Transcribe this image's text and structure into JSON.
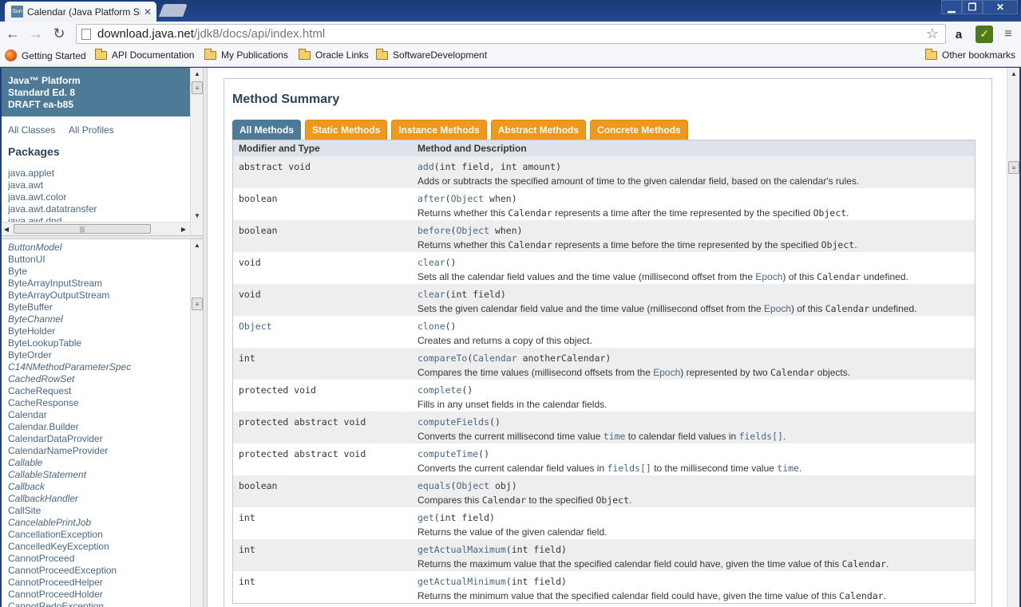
{
  "browser": {
    "tab_title": "Calendar (Java Platform SE",
    "tab_favicon": "Sun",
    "url_host": "download.java.net",
    "url_path": "/jdk8/docs/api/index.html",
    "bookmarks": [
      "Getting Started",
      "API Documentation",
      "My Publications",
      "Oracle Links",
      "SoftwareDevelopment"
    ],
    "other_bookmarks": "Other bookmarks"
  },
  "sidebar": {
    "platform_lines": [
      "Java™ Platform",
      "Standard Ed. 8",
      "DRAFT ea-b85"
    ],
    "all_classes": "All Classes",
    "all_profiles": "All Profiles",
    "packages_title": "Packages",
    "packages": [
      "java.applet",
      "java.awt",
      "java.awt.color",
      "java.awt.datatransfer",
      "java.awt.dnd"
    ],
    "classes": [
      {
        "name": "ButtonModel",
        "italic": true
      },
      {
        "name": "ButtonUI",
        "italic": false
      },
      {
        "name": "Byte",
        "italic": false
      },
      {
        "name": "ByteArrayInputStream",
        "italic": false
      },
      {
        "name": "ByteArrayOutputStream",
        "italic": false
      },
      {
        "name": "ByteBuffer",
        "italic": false
      },
      {
        "name": "ByteChannel",
        "italic": true
      },
      {
        "name": "ByteHolder",
        "italic": false
      },
      {
        "name": "ByteLookupTable",
        "italic": false
      },
      {
        "name": "ByteOrder",
        "italic": false
      },
      {
        "name": "C14NMethodParameterSpec",
        "italic": true
      },
      {
        "name": "CachedRowSet",
        "italic": true
      },
      {
        "name": "CacheRequest",
        "italic": false
      },
      {
        "name": "CacheResponse",
        "italic": false
      },
      {
        "name": "Calendar",
        "italic": false
      },
      {
        "name": "Calendar.Builder",
        "italic": false
      },
      {
        "name": "CalendarDataProvider",
        "italic": false
      },
      {
        "name": "CalendarNameProvider",
        "italic": false
      },
      {
        "name": "Callable",
        "italic": true
      },
      {
        "name": "CallableStatement",
        "italic": true
      },
      {
        "name": "Callback",
        "italic": true
      },
      {
        "name": "CallbackHandler",
        "italic": true
      },
      {
        "name": "CallSite",
        "italic": false
      },
      {
        "name": "CancelablePrintJob",
        "italic": true
      },
      {
        "name": "CancellationException",
        "italic": false
      },
      {
        "name": "CancelledKeyException",
        "italic": false
      },
      {
        "name": "CannotProceed",
        "italic": false
      },
      {
        "name": "CannotProceedException",
        "italic": false
      },
      {
        "name": "CannotProceedHelper",
        "italic": false
      },
      {
        "name": "CannotProceedHolder",
        "italic": false
      },
      {
        "name": "CannotRedoException",
        "italic": false
      }
    ]
  },
  "main": {
    "heading": "Method Summary",
    "tabs": [
      "All Methods",
      "Static Methods",
      "Instance Methods",
      "Abstract Methods",
      "Concrete Methods"
    ],
    "columns": [
      "Modifier and Type",
      "Method and Description"
    ],
    "rows": [
      {
        "type": [
          [
            "abstract void",
            0
          ]
        ],
        "sig": [
          [
            "add",
            1
          ],
          [
            "(int field, int amount)",
            0
          ]
        ],
        "desc": [
          [
            "Adds or subtracts the specified amount of time to the given calendar field, based on the calendar's rules.",
            "t"
          ]
        ]
      },
      {
        "type": [
          [
            "boolean",
            0
          ]
        ],
        "sig": [
          [
            "after",
            1
          ],
          [
            "(",
            0
          ],
          [
            "Object",
            1
          ],
          [
            " when)",
            0
          ]
        ],
        "desc": [
          [
            "Returns whether this ",
            "t"
          ],
          [
            "Calendar",
            "m"
          ],
          [
            " represents a time after the time represented by the specified ",
            "t"
          ],
          [
            "Object",
            "m"
          ],
          [
            ".",
            "t"
          ]
        ]
      },
      {
        "type": [
          [
            "boolean",
            0
          ]
        ],
        "sig": [
          [
            "before",
            1
          ],
          [
            "(",
            0
          ],
          [
            "Object",
            1
          ],
          [
            " when)",
            0
          ]
        ],
        "desc": [
          [
            "Returns whether this ",
            "t"
          ],
          [
            "Calendar",
            "m"
          ],
          [
            " represents a time before the time represented by the specified ",
            "t"
          ],
          [
            "Object",
            "m"
          ],
          [
            ".",
            "t"
          ]
        ]
      },
      {
        "type": [
          [
            "void",
            0
          ]
        ],
        "sig": [
          [
            "clear",
            1
          ],
          [
            "()",
            0
          ]
        ],
        "desc": [
          [
            "Sets all the calendar field values and the time value (millisecond offset from the ",
            "t"
          ],
          [
            "Epoch",
            "l"
          ],
          [
            ") of this ",
            "t"
          ],
          [
            "Calendar",
            "m"
          ],
          [
            " undefined.",
            "t"
          ]
        ]
      },
      {
        "type": [
          [
            "void",
            0
          ]
        ],
        "sig": [
          [
            "clear",
            1
          ],
          [
            "(int field)",
            0
          ]
        ],
        "desc": [
          [
            "Sets the given calendar field value and the time value (millisecond offset from the ",
            "t"
          ],
          [
            "Epoch",
            "l"
          ],
          [
            ") of this ",
            "t"
          ],
          [
            "Calendar",
            "m"
          ],
          [
            " undefined.",
            "t"
          ]
        ]
      },
      {
        "type": [
          [
            "Object",
            1
          ]
        ],
        "sig": [
          [
            "clone",
            1
          ],
          [
            "()",
            0
          ]
        ],
        "desc": [
          [
            "Creates and returns a copy of this object.",
            "t"
          ]
        ]
      },
      {
        "type": [
          [
            "int",
            0
          ]
        ],
        "sig": [
          [
            "compareTo",
            1
          ],
          [
            "(",
            0
          ],
          [
            "Calendar",
            1
          ],
          [
            " anotherCalendar)",
            0
          ]
        ],
        "desc": [
          [
            "Compares the time values (millisecond offsets from the ",
            "t"
          ],
          [
            "Epoch",
            "l"
          ],
          [
            ") represented by two ",
            "t"
          ],
          [
            "Calendar",
            "m"
          ],
          [
            " objects.",
            "t"
          ]
        ]
      },
      {
        "type": [
          [
            "protected void",
            0
          ]
        ],
        "sig": [
          [
            "complete",
            1
          ],
          [
            "()",
            0
          ]
        ],
        "desc": [
          [
            "Fills in any unset fields in the calendar fields.",
            "t"
          ]
        ]
      },
      {
        "type": [
          [
            "protected abstract void",
            0
          ]
        ],
        "sig": [
          [
            "computeFields",
            1
          ],
          [
            "()",
            0
          ]
        ],
        "desc": [
          [
            "Converts the current millisecond time value ",
            "t"
          ],
          [
            "time",
            "ml"
          ],
          [
            " to calendar field values in ",
            "t"
          ],
          [
            "fields[]",
            "ml"
          ],
          [
            ".",
            "t"
          ]
        ]
      },
      {
        "type": [
          [
            "protected abstract void",
            0
          ]
        ],
        "sig": [
          [
            "computeTime",
            1
          ],
          [
            "()",
            0
          ]
        ],
        "desc": [
          [
            "Converts the current calendar field values in ",
            "t"
          ],
          [
            "fields[]",
            "ml"
          ],
          [
            " to the millisecond time value ",
            "t"
          ],
          [
            "time",
            "ml"
          ],
          [
            ".",
            "t"
          ]
        ]
      },
      {
        "type": [
          [
            "boolean",
            0
          ]
        ],
        "sig": [
          [
            "equals",
            1
          ],
          [
            "(",
            0
          ],
          [
            "Object",
            1
          ],
          [
            " obj)",
            0
          ]
        ],
        "desc": [
          [
            "Compares this ",
            "t"
          ],
          [
            "Calendar",
            "m"
          ],
          [
            " to the specified ",
            "t"
          ],
          [
            "Object",
            "m"
          ],
          [
            ".",
            "t"
          ]
        ]
      },
      {
        "type": [
          [
            "int",
            0
          ]
        ],
        "sig": [
          [
            "get",
            1
          ],
          [
            "(int field)",
            0
          ]
        ],
        "desc": [
          [
            "Returns the value of the given calendar field.",
            "t"
          ]
        ]
      },
      {
        "type": [
          [
            "int",
            0
          ]
        ],
        "sig": [
          [
            "getActualMaximum",
            1
          ],
          [
            "(int field)",
            0
          ]
        ],
        "desc": [
          [
            "Returns the maximum value that the specified calendar field could have, given the time value of this ",
            "t"
          ],
          [
            "Calendar",
            "m"
          ],
          [
            ".",
            "t"
          ]
        ]
      },
      {
        "type": [
          [
            "int",
            0
          ]
        ],
        "sig": [
          [
            "getActualMinimum",
            1
          ],
          [
            "(int field)",
            0
          ]
        ],
        "desc": [
          [
            "Returns the minimum value that the specified calendar field could have, given the time value of this ",
            "t"
          ],
          [
            "Calendar",
            "m"
          ],
          [
            ".",
            "t"
          ]
        ]
      }
    ]
  }
}
